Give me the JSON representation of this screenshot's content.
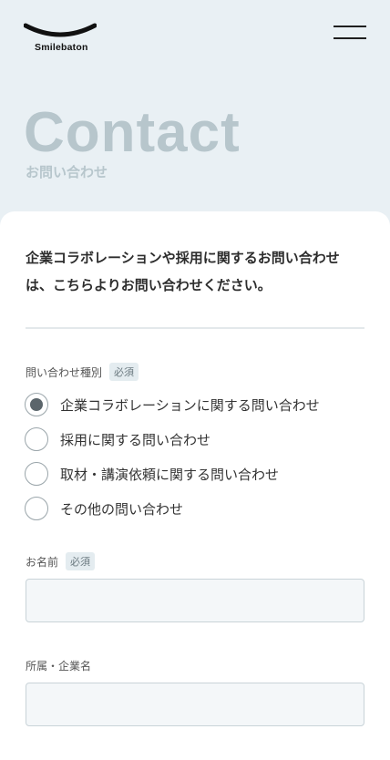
{
  "header": {
    "logo_text": "Smilebaton"
  },
  "hero": {
    "title": "Contact",
    "subtitle": "お問い合わせ"
  },
  "intro": {
    "line1": "企業コラボレーションや採用に関するお問い合わせ",
    "line2": "は、こちらよりお問い合わせください。"
  },
  "form": {
    "inquiry_type": {
      "label": "問い合わせ種別",
      "required": "必須",
      "options": [
        {
          "label": "企業コラボレーションに関する問い合わせ",
          "selected": true
        },
        {
          "label": "採用に関する問い合わせ",
          "selected": false
        },
        {
          "label": "取材・講演依頼に関する問い合わせ",
          "selected": false
        },
        {
          "label": "その他の問い合わせ",
          "selected": false
        }
      ]
    },
    "name": {
      "label": "お名前",
      "required": "必須",
      "value": ""
    },
    "company": {
      "label": "所属・企業名",
      "value": ""
    }
  },
  "colors": {
    "page_bg": "#e9f0f4",
    "hero_text": "#b7c6cc",
    "radio_selected": "#5b656b"
  }
}
